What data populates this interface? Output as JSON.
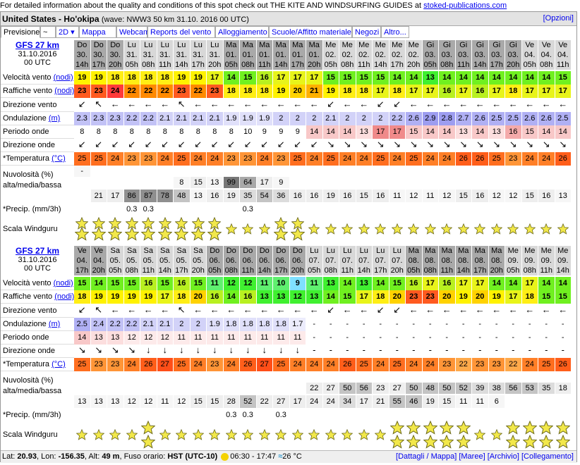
{
  "top_info": {
    "text": "For detailed information about the quality and conditions of this spot check out THE KITE AND WINDSURFING GUIDES at ",
    "link": "stoked-publications.com"
  },
  "header": {
    "title": "United States - Ho'okipa",
    "wave_info": "(wave: NWW3 50 km 31.10. 2016 00 UTC)",
    "options": "[Opzioni]"
  },
  "tabs": [
    "Previsione",
    "~",
    "2D ▾",
    "Mappa",
    "Webcams",
    "Reports del vento",
    "Alloggiamento",
    "Scuole/Affitto materiale",
    "Negozi",
    "Altro..."
  ],
  "row_labels": {
    "wind_speed": "Velocità vento",
    "wind_speed_unit": "(nodi)",
    "gusts": "Raffiche vento",
    "gusts_unit": "(nodi)",
    "wind_dir": "Direzione vento",
    "wave": "Ondulazione",
    "wave_unit": "(m)",
    "period": "Periodo onde",
    "wave_dir": "Direzione onde",
    "temp": "*Temperatura",
    "temp_unit": "(°C)",
    "cloud1": "Nuvolosità (%)",
    "cloud2": "alta/media/bassa",
    "precip": "*Precip. (mm/3h)",
    "rating": "Scala Windguru"
  },
  "blocks": [
    {
      "model": "GFS 27 km",
      "date": "31.10.2016",
      "utc": "00 UTC",
      "days": [
        "Do",
        "Do",
        "Do",
        "Lu",
        "Lu",
        "Lu",
        "Lu",
        "Lu",
        "Lu",
        "Ma",
        "Ma",
        "Ma",
        "Ma",
        "Ma",
        "Ma",
        "Me",
        "Me",
        "Me",
        "Me",
        "Me",
        "Me",
        "Gi",
        "Gi",
        "Gi",
        "Gi",
        "Gi",
        "Gi",
        "Ve",
        "Ve",
        "Ve"
      ],
      "dates": [
        "30.",
        "30.",
        "30.",
        "31.",
        "31.",
        "31.",
        "31.",
        "31.",
        "31.",
        "01.",
        "01.",
        "01.",
        "01.",
        "01.",
        "01.",
        "02.",
        "02.",
        "02.",
        "02.",
        "02.",
        "02.",
        "03.",
        "03.",
        "03.",
        "03.",
        "03.",
        "03.",
        "04.",
        "04.",
        "04."
      ],
      "hours": [
        "14h",
        "17h",
        "20h",
        "05h",
        "08h",
        "11h",
        "14h",
        "17h",
        "20h",
        "05h",
        "08h",
        "11h",
        "14h",
        "17h",
        "20h",
        "05h",
        "08h",
        "11h",
        "14h",
        "17h",
        "20h",
        "05h",
        "08h",
        "11h",
        "14h",
        "17h",
        "20h",
        "05h",
        "08h",
        "11h"
      ],
      "wind": [
        "19",
        "19",
        "18",
        "18",
        "18",
        "18",
        "19",
        "19",
        "17",
        "14",
        "15",
        "16",
        "17",
        "17",
        "17",
        "15",
        "15",
        "15",
        "15",
        "14",
        "14",
        "13",
        "14",
        "14",
        "14",
        "14",
        "14",
        "14",
        "14",
        "15"
      ],
      "gusts": [
        "23",
        "23",
        "24",
        "22",
        "22",
        "22",
        "23",
        "22",
        "23",
        "18",
        "18",
        "18",
        "19",
        "20",
        "21",
        "19",
        "18",
        "18",
        "17",
        "18",
        "17",
        "17",
        "16",
        "17",
        "16",
        "17",
        "18",
        "17",
        "17",
        "17"
      ],
      "wave": [
        "2.3",
        "2.3",
        "2.3",
        "2.2",
        "2.2",
        "2.1",
        "2.1",
        "2.1",
        "2.1",
        "1.9",
        "1.9",
        "1.9",
        "2",
        "2",
        "2",
        "2.1",
        "2",
        "2",
        "2",
        "2.2",
        "2.6",
        "2.9",
        "2.8",
        "2.7",
        "2.6",
        "2.5",
        "2.5",
        "2.6",
        "2.6",
        "2.5"
      ],
      "period": [
        "8",
        "8",
        "8",
        "8",
        "8",
        "8",
        "8",
        "8",
        "8",
        "8",
        "10",
        "9",
        "9",
        "9",
        "14",
        "14",
        "14",
        "13",
        "17",
        "17",
        "15",
        "14",
        "14",
        "13",
        "14",
        "13",
        "16",
        "15",
        "14",
        "14"
      ],
      "temp": [
        "25",
        "25",
        "24",
        "23",
        "23",
        "24",
        "25",
        "24",
        "24",
        "23",
        "23",
        "24",
        "23",
        "25",
        "24",
        "25",
        "24",
        "24",
        "25",
        "24",
        "25",
        "24",
        "24",
        "26",
        "26",
        "25",
        "23",
        "24",
        "24",
        "26"
      ],
      "cloud_high": [
        "-",
        "",
        "",
        "",
        "",
        "",
        "",
        "",
        "",
        "",
        "",
        "",
        "",
        "",
        "",
        "",
        "",
        "",
        "",
        "",
        "",
        "",
        "",
        "",
        "",
        "",
        "",
        "",
        "",
        ""
      ],
      "cloud_mid": [
        "",
        "",
        "",
        "",
        "",
        "",
        "8",
        "15",
        "13",
        "99",
        "64",
        "17",
        "9",
        "",
        "",
        "",
        "",
        "",
        "",
        "",
        "",
        "",
        "",
        "",
        "",
        "",
        "",
        "",
        "",
        ""
      ],
      "cloud_low": [
        "",
        "21",
        "17",
        "86",
        "87",
        "78",
        "48",
        "13",
        "16",
        "19",
        "35",
        "54",
        "36",
        "16",
        "16",
        "19",
        "16",
        "15",
        "16",
        "11",
        "12",
        "11",
        "12",
        "15",
        "16",
        "12",
        "12",
        "15",
        "16",
        "13"
      ],
      "precip": [
        "",
        "",
        "",
        "0.3",
        "0.3",
        "",
        "",
        "",
        "",
        "",
        "0.3",
        "",
        "",
        "",
        "",
        "",
        "",
        "",
        "",
        "",
        "",
        "",
        "",
        "",
        "",
        "",
        "",
        "",
        "",
        ""
      ],
      "stars": [
        3,
        3,
        3,
        3,
        3,
        3,
        3,
        3,
        3,
        1,
        1,
        1,
        3,
        3,
        1,
        1,
        1,
        1,
        1,
        1,
        1,
        1,
        1,
        1,
        1,
        1,
        1,
        1,
        1,
        1
      ]
    },
    {
      "model": "GFS 27 km",
      "date": "31.10.2016",
      "utc": "00 UTC",
      "days": [
        "Ve",
        "Ve",
        "Sa",
        "Sa",
        "Sa",
        "Sa",
        "Sa",
        "Sa",
        "Do",
        "Do",
        "Do",
        "Do",
        "Do",
        "Do",
        "Lu",
        "Lu",
        "Lu",
        "Lu",
        "Lu",
        "Lu",
        "Ma",
        "Ma",
        "Ma",
        "Ma",
        "Ma",
        "Ma",
        "Me",
        "Me",
        "Me",
        "Me"
      ],
      "dates": [
        "04.",
        "04.",
        "05.",
        "05.",
        "05.",
        "05.",
        "05.",
        "05.",
        "06.",
        "06.",
        "06.",
        "06.",
        "06.",
        "06.",
        "07.",
        "07.",
        "07.",
        "07.",
        "07.",
        "07.",
        "08.",
        "08.",
        "08.",
        "08.",
        "08.",
        "08.",
        "09.",
        "09.",
        "09.",
        "09."
      ],
      "hours": [
        "17h",
        "20h",
        "05h",
        "08h",
        "11h",
        "14h",
        "17h",
        "20h",
        "05h",
        "08h",
        "11h",
        "14h",
        "17h",
        "20h",
        "05h",
        "08h",
        "11h",
        "14h",
        "17h",
        "20h",
        "05h",
        "08h",
        "11h",
        "14h",
        "17h",
        "20h",
        "05h",
        "08h",
        "11h",
        "14h"
      ],
      "wind": [
        "15",
        "14",
        "15",
        "15",
        "16",
        "15",
        "16",
        "15",
        "11",
        "12",
        "12",
        "11",
        "10",
        "9",
        "11",
        "13",
        "14",
        "13",
        "14",
        "15",
        "16",
        "17",
        "16",
        "17",
        "17",
        "14",
        "14",
        "17",
        "14",
        "14"
      ],
      "gusts": [
        "18",
        "19",
        "19",
        "19",
        "19",
        "17",
        "18",
        "20",
        "16",
        "14",
        "16",
        "13",
        "13",
        "12",
        "13",
        "14",
        "15",
        "17",
        "18",
        "20",
        "23",
        "23",
        "20",
        "19",
        "20",
        "19",
        "17",
        "18",
        "15",
        "15"
      ],
      "wave": [
        "2.5",
        "2.4",
        "2.2",
        "2.2",
        "2.1",
        "2.1",
        "2",
        "2",
        "1.9",
        "1.8",
        "1.8",
        "1.8",
        "1.8",
        "1.7",
        "-",
        "-",
        "-",
        "-",
        "-",
        "-",
        "-",
        "-",
        "-",
        "-",
        "-",
        "-",
        "-",
        "-",
        "-",
        "-"
      ],
      "period": [
        "14",
        "13",
        "13",
        "12",
        "12",
        "12",
        "11",
        "11",
        "11",
        "11",
        "11",
        "11",
        "11",
        "11",
        "-",
        "-",
        "-",
        "-",
        "-",
        "-",
        "-",
        "-",
        "-",
        "-",
        "-",
        "-",
        "-",
        "-",
        "-",
        "-"
      ],
      "temp": [
        "25",
        "23",
        "23",
        "24",
        "26",
        "27",
        "25",
        "24",
        "23",
        "24",
        "26",
        "27",
        "25",
        "24",
        "24",
        "24",
        "26",
        "25",
        "24",
        "25",
        "24",
        "24",
        "23",
        "22",
        "23",
        "23",
        "22",
        "24",
        "25",
        "26"
      ],
      "cloud_high": [
        "",
        "",
        "",
        "",
        "",
        "",
        "",
        "",
        "",
        "",
        "",
        "",
        "",
        "",
        "",
        "",
        "",
        "",
        "",
        "",
        "",
        "",
        "",
        "",
        "",
        "",
        "",
        "",
        "",
        ""
      ],
      "cloud_mid": [
        "",
        "",
        "",
        "",
        "",
        "",
        "",
        "",
        "",
        "",
        "",
        "",
        "",
        "",
        "22",
        "27",
        "50",
        "56",
        "23",
        "27",
        "50",
        "48",
        "50",
        "52",
        "39",
        "38",
        "56",
        "53",
        "35",
        "18"
      ],
      "cloud_low": [
        "13",
        "13",
        "13",
        "12",
        "12",
        "11",
        "12",
        "15",
        "15",
        "28",
        "52",
        "22",
        "27",
        "17",
        "24",
        "24",
        "34",
        "17",
        "21",
        "55",
        "46",
        "19",
        "15",
        "11",
        "11",
        "6",
        "",
        "",
        "",
        ""
      ],
      "precip": [
        "",
        "",
        "",
        "",
        "",
        "",
        "",
        "",
        "",
        "0.3",
        "0.3",
        "",
        "0.3",
        "",
        "",
        "",
        "",
        "",
        "",
        "",
        "",
        "",
        "",
        "",
        "",
        "",
        "",
        "",
        "",
        ""
      ],
      "stars": [
        1,
        1,
        1,
        1,
        2,
        1,
        1,
        1,
        1,
        1,
        1,
        1,
        1,
        1,
        1,
        1,
        1,
        1,
        1,
        2,
        2,
        2,
        2,
        2,
        1,
        1,
        2,
        2,
        2,
        2
      ]
    }
  ],
  "footer": {
    "lat_label": "Lat:",
    "lat": "20.93",
    "lon_label": "Lon:",
    "lon": "-156.35",
    "alt_label": "Alt:",
    "alt": "49 m",
    "tz_label": "Fuso orario:",
    "tz": "HST (UTC-10)",
    "sun_times": "06:30 - 17:47",
    "water_temp": "26 °C",
    "links": [
      "[Dattagli / Mappa]",
      "[Maree]",
      "[Archivio]",
      "[Collegamento]"
    ]
  },
  "colors": {
    "day_dark": "#a9a9a9",
    "day_light": "#d8d8d8",
    "temp_orange": "#ff7417",
    "temp_red": "#ff5a1a",
    "period_pink": "#f7c3c3",
    "wave_purple": "#b4b4f4"
  }
}
